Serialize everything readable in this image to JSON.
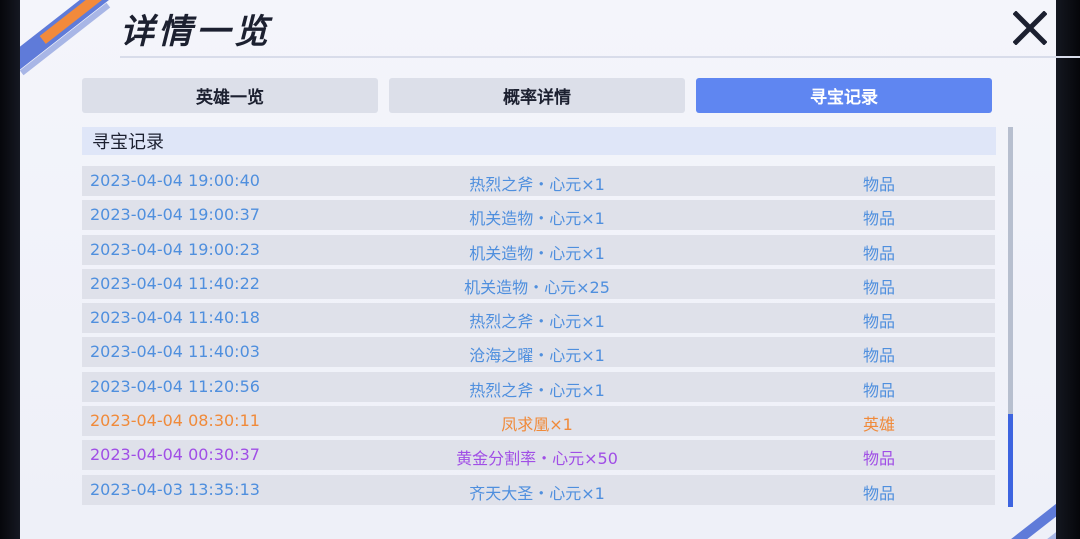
{
  "window": {
    "title": "详情一览",
    "close_label": "X"
  },
  "tabs": [
    {
      "label": "英雄一览"
    },
    {
      "label": "概率详情"
    },
    {
      "label": "寻宝记录"
    }
  ],
  "section": {
    "title": "寻宝记录"
  },
  "records": [
    {
      "time": "2023-04-04 19:00:40",
      "item": "热烈之斧・心元×1",
      "type": "物品",
      "color": "#4f8fde"
    },
    {
      "time": "2023-04-04 19:00:37",
      "item": "机关造物・心元×1",
      "type": "物品",
      "color": "#4f8fde"
    },
    {
      "time": "2023-04-04 19:00:23",
      "item": "机关造物・心元×1",
      "type": "物品",
      "color": "#4f8fde"
    },
    {
      "time": "2023-04-04 11:40:22",
      "item": "机关造物・心元×25",
      "type": "物品",
      "color": "#4f8fde"
    },
    {
      "time": "2023-04-04 11:40:18",
      "item": "热烈之斧・心元×1",
      "type": "物品",
      "color": "#4f8fde"
    },
    {
      "time": "2023-04-04 11:40:03",
      "item": "沧海之曜・心元×1",
      "type": "物品",
      "color": "#4f8fde"
    },
    {
      "time": "2023-04-04 11:20:56",
      "item": "热烈之斧・心元×1",
      "type": "物品",
      "color": "#4f8fde"
    },
    {
      "time": "2023-04-04 08:30:11",
      "item": "凤求凰×1",
      "type": "英雄",
      "color": "#f08a3a"
    },
    {
      "time": "2023-04-04 00:30:37",
      "item": "黄金分割率・心元×50",
      "type": "物品",
      "color": "#a04ee6"
    },
    {
      "time": "2023-04-03 13:35:13",
      "item": "齐天大圣・心元×1",
      "type": "物品",
      "color": "#4f8fde"
    }
  ],
  "colors": {
    "accent": "#5f86f1",
    "normal_text": "#4f8fde",
    "hero_text": "#f08a3a",
    "rare_text": "#a04ee6"
  }
}
